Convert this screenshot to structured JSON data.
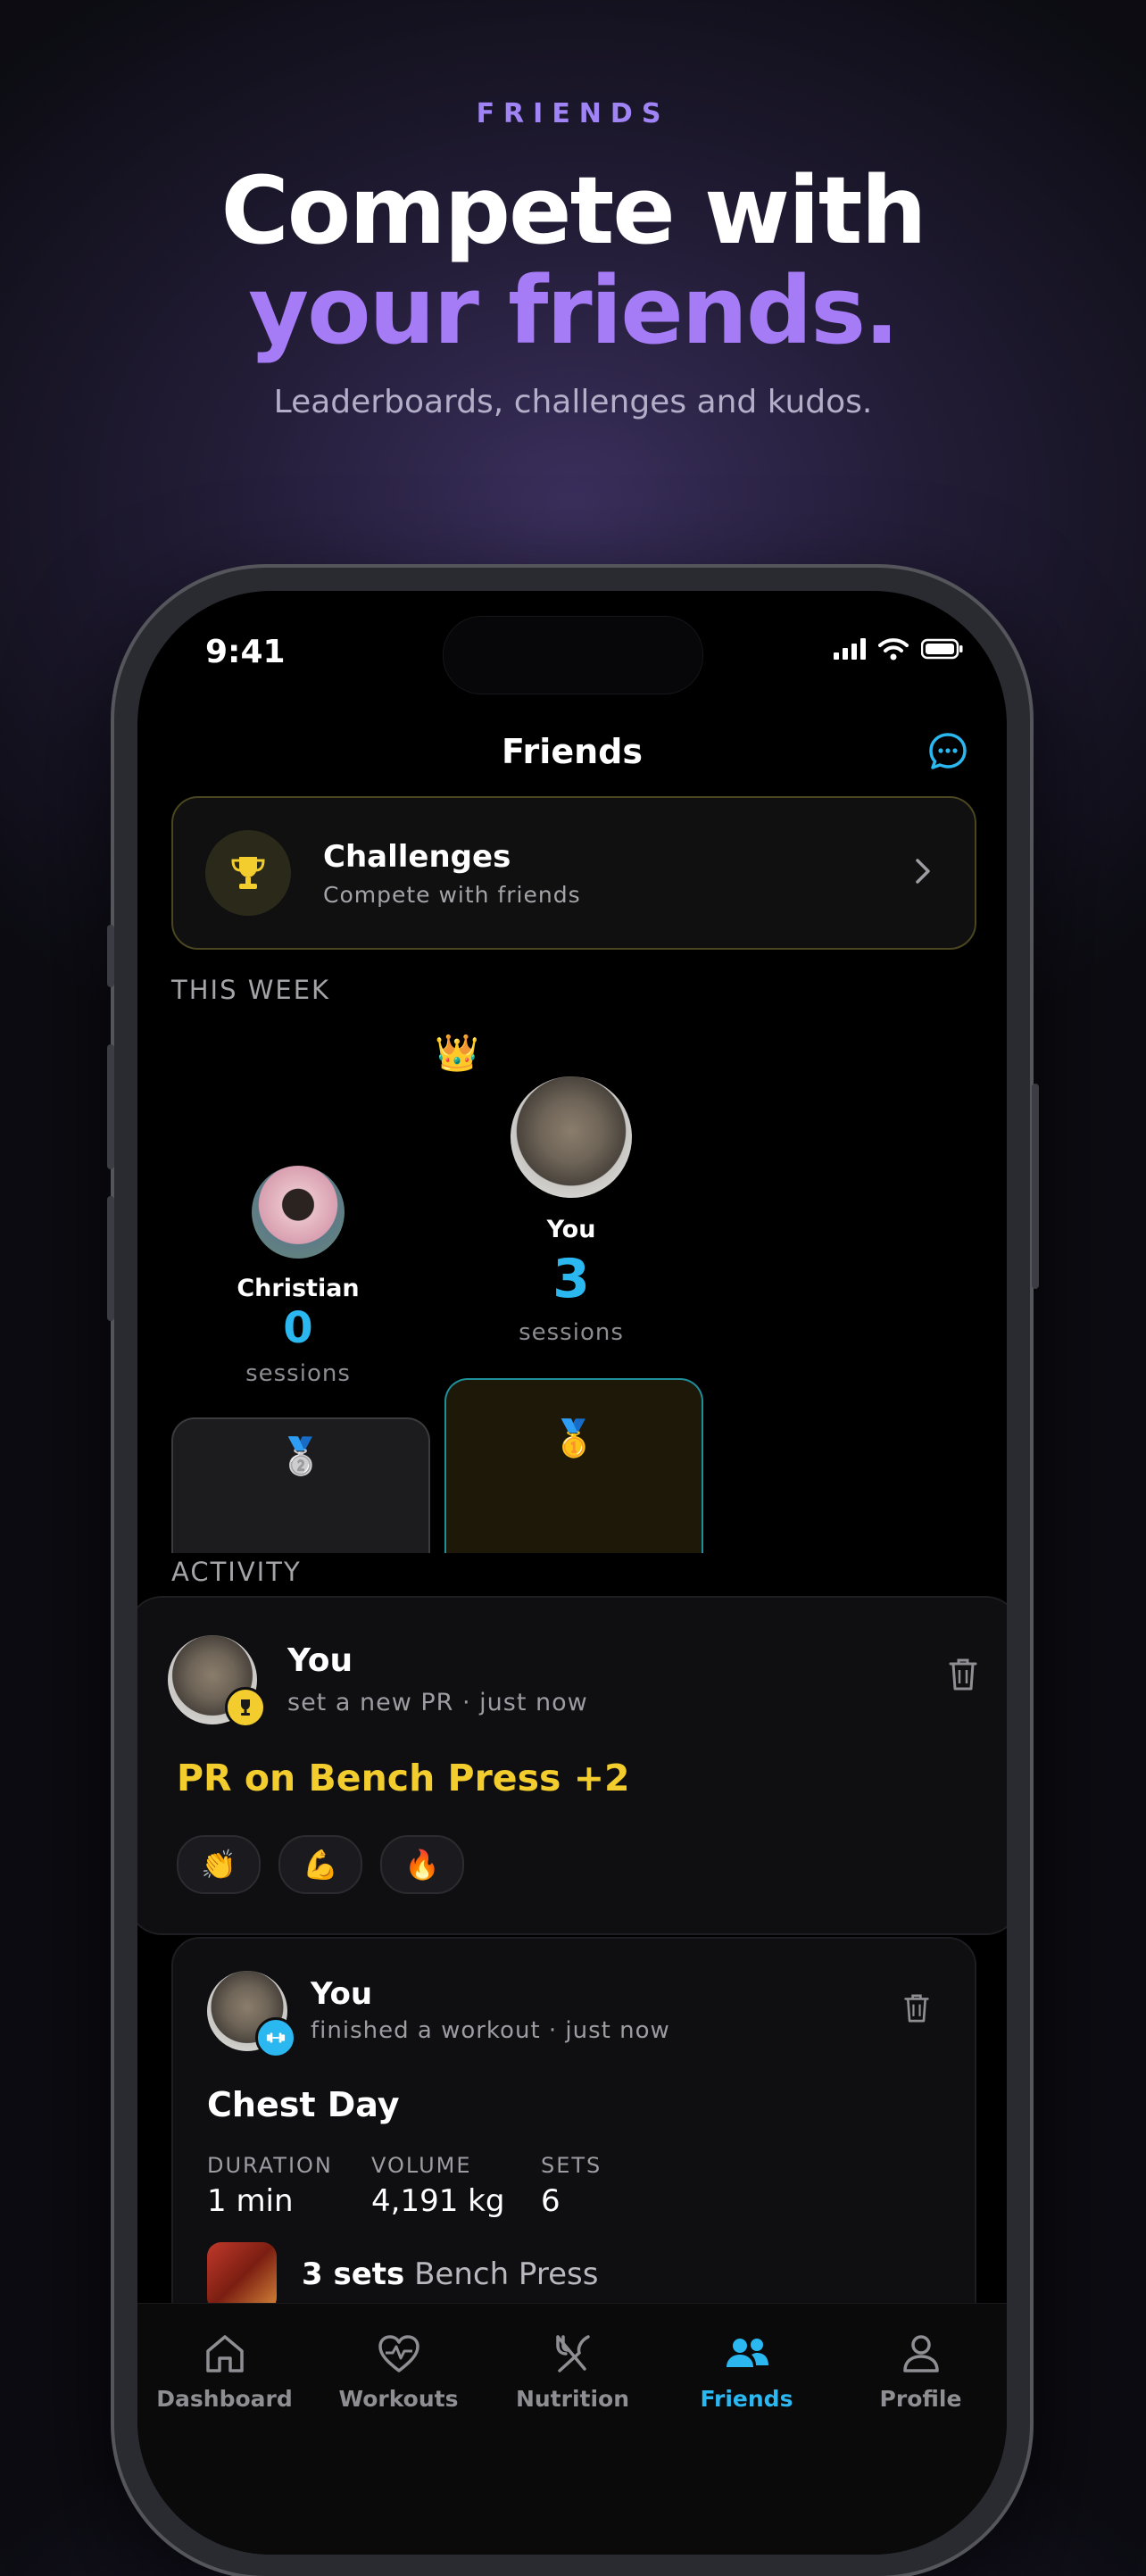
{
  "hero": {
    "eyebrow": "FRIENDS",
    "title_line1": "Compete with",
    "title_line2": "your friends.",
    "subtitle": "Leaderboards, challenges and kudos."
  },
  "status": {
    "time": "9:41"
  },
  "nav": {
    "title": "Friends"
  },
  "challenges": {
    "title": "Challenges",
    "subtitle": "Compete with friends"
  },
  "week": {
    "label": "THIS WEEK",
    "first": {
      "name": "You",
      "sessions": "3",
      "unit": "sessions",
      "medal": "🥇",
      "crown": "👑"
    },
    "second": {
      "name": "Christian",
      "sessions": "0",
      "unit": "sessions",
      "medal": "🥈"
    }
  },
  "activity": {
    "label": "ACTIVITY",
    "pr_post": {
      "name": "You",
      "subtitle": "set a new PR · just now",
      "headline": "PR on Bench Press +2",
      "reactions": [
        "👏",
        "💪",
        "🔥"
      ]
    },
    "workout_post": {
      "name": "You",
      "subtitle": "finished a workout · just now",
      "title": "Chest Day",
      "stats": [
        {
          "label": "DURATION",
          "value": "1 min"
        },
        {
          "label": "VOLUME",
          "value": "4,191 kg"
        },
        {
          "label": "SETS",
          "value": "6"
        }
      ],
      "exercise": {
        "sets": "3 sets",
        "name": "Bench Press"
      }
    }
  },
  "tabs": [
    {
      "label": "Dashboard",
      "icon": "home-icon",
      "active": false
    },
    {
      "label": "Workouts",
      "icon": "heart-pulse-icon",
      "active": false
    },
    {
      "label": "Nutrition",
      "icon": "fork-knife-icon",
      "active": false
    },
    {
      "label": "Friends",
      "icon": "people-icon",
      "active": true
    },
    {
      "label": "Profile",
      "icon": "person-icon",
      "active": false
    }
  ],
  "colors": {
    "accent_blue": "#2bb8f0",
    "accent_purple": "#a57cf5",
    "gold": "#f2cd2d"
  }
}
